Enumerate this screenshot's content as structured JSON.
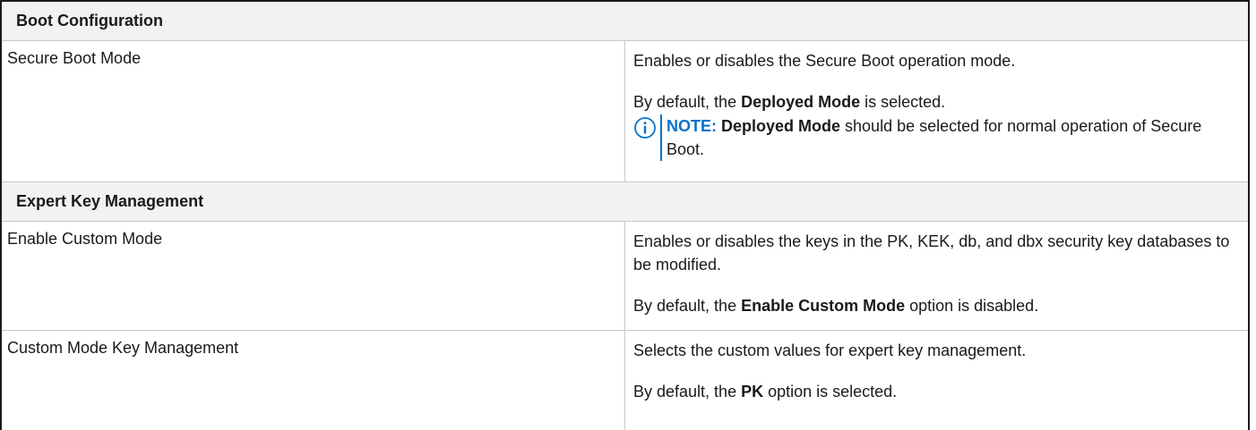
{
  "sections": [
    {
      "title": "Boot Configuration",
      "rows": [
        {
          "name": "Secure Boot Mode",
          "description": "Enables or disables the Secure Boot operation mode.",
          "default_prefix": "By default, the ",
          "default_bold": "Deployed Mode",
          "default_suffix": " is selected.",
          "note_label": "NOTE:",
          "note_bold": "Deployed Mode",
          "note_rest": " should be selected for normal operation of Secure Boot."
        }
      ]
    },
    {
      "title": "Expert Key Management",
      "rows": [
        {
          "name": "Enable Custom Mode",
          "description": "Enables or disables the keys in the PK, KEK, db, and dbx security key databases to be modified.",
          "default_prefix": "By default, the ",
          "default_bold": "Enable Custom Mode",
          "default_suffix": " option is disabled."
        },
        {
          "name": "Custom Mode Key Management",
          "description": "Selects the custom values for expert key management.",
          "default_prefix": "By default, the ",
          "default_bold": "PK",
          "default_suffix": " option is selected."
        }
      ]
    }
  ],
  "icons": {
    "note": "info-icon"
  },
  "colors": {
    "note_accent": "#0672cb",
    "header_background": "#f2f2f2",
    "border": "#1a1a1a",
    "divider": "#c8c8c8"
  }
}
